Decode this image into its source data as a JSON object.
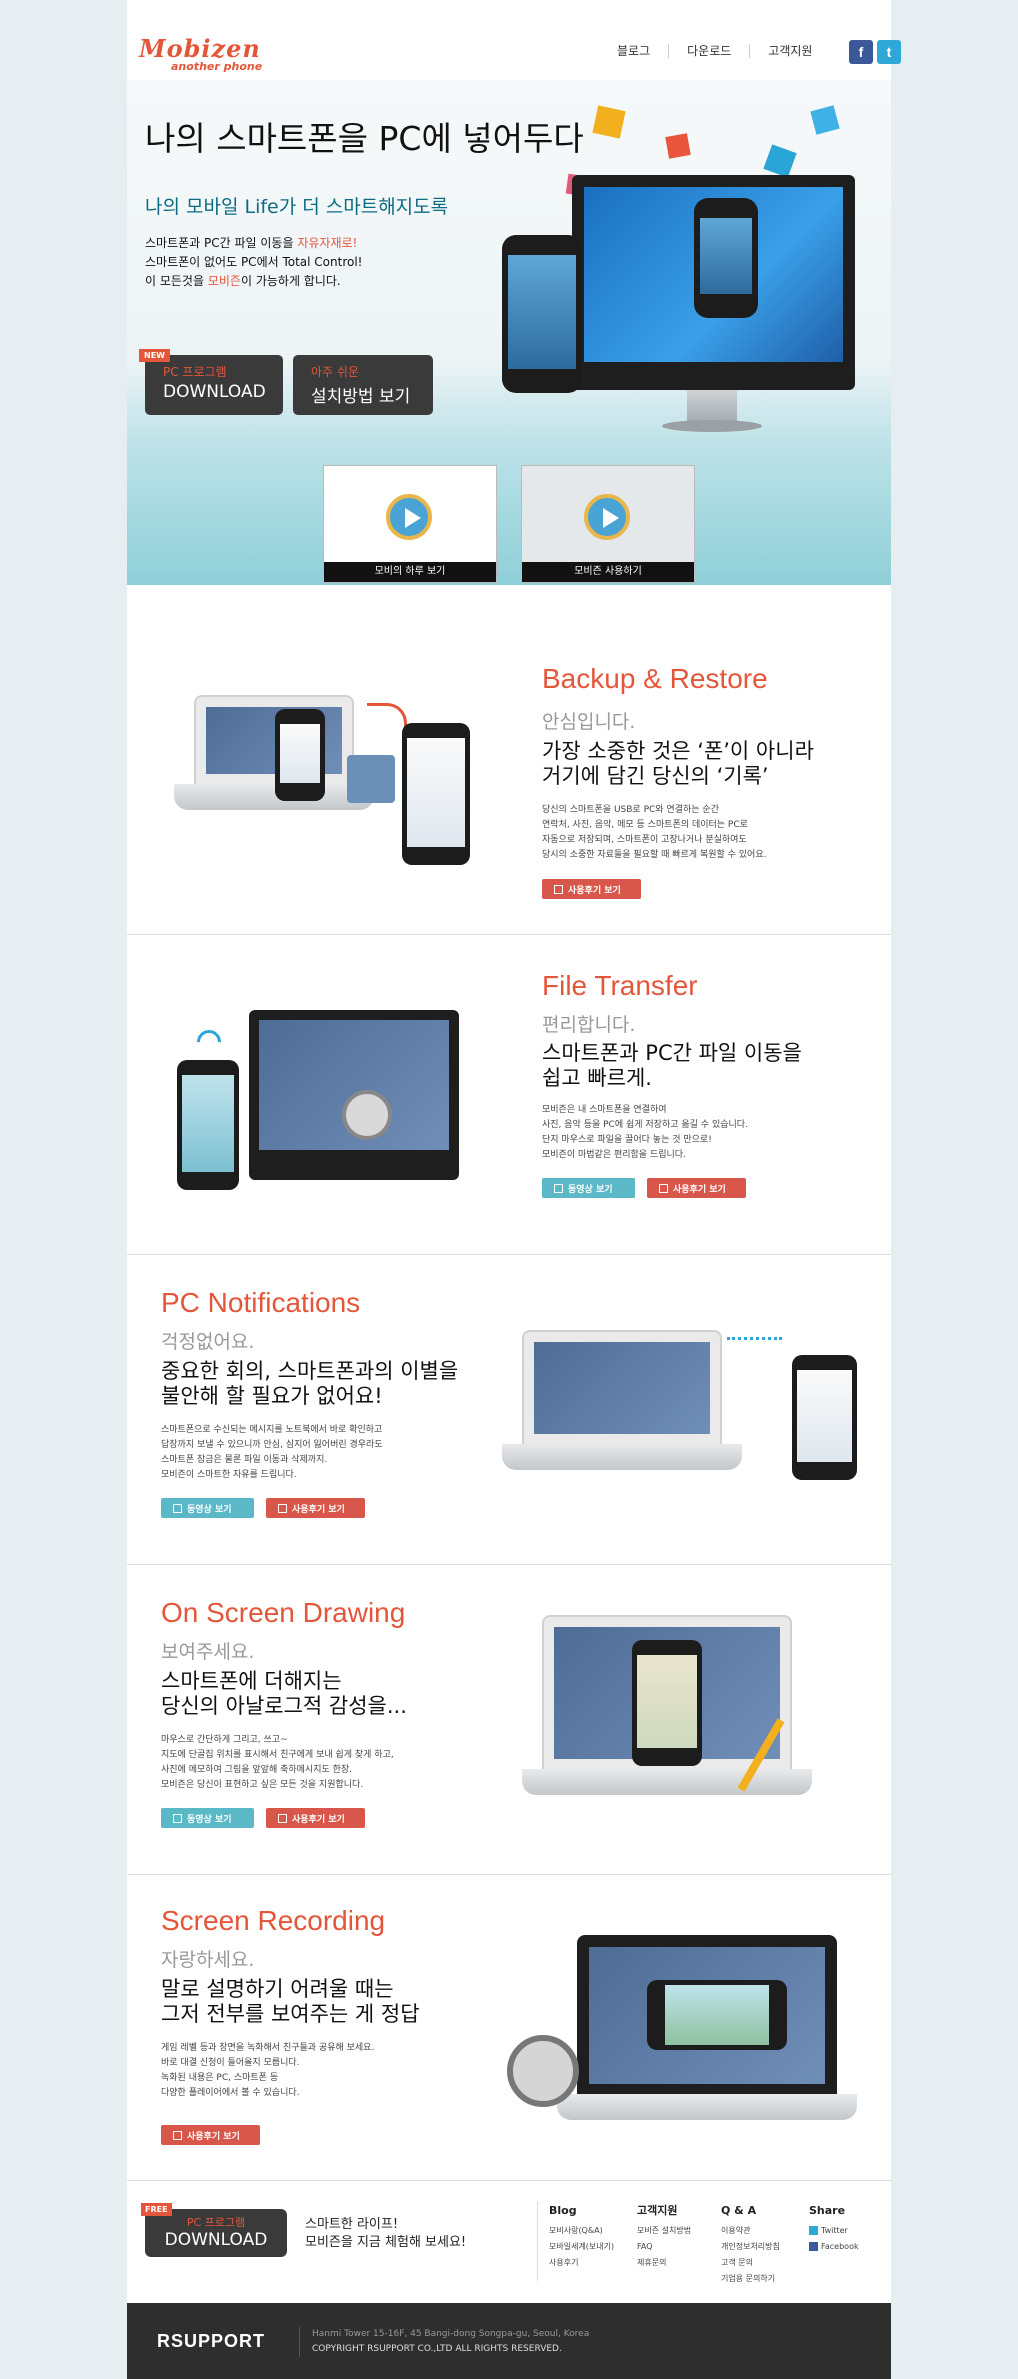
{
  "header": {
    "logo_main": "Mobizen",
    "logo_sub": "another phone",
    "nav": [
      "블로그",
      "다운로드",
      "고객지원"
    ],
    "social": [
      "f",
      "t"
    ]
  },
  "hero": {
    "title": "나의 스마트폰을 PC에 넣어두다",
    "subtitle": "나의 모바일 Life가 더 스마트해지도록",
    "line1_a": "스마트폰과 PC간 파일 이동을 ",
    "line1_b": "자유자재로!",
    "line2": "스마트폰이 없어도 PC에서 Total Control!",
    "line3_a": "이 모든것을 ",
    "line3_b": "모비즌",
    "line3_c": "이 가능하게 합니다.",
    "btn_download_tag": "NEW",
    "btn_download_small": "PC 프로그램",
    "btn_download_big": "DOWNLOAD",
    "btn_install_small": "아주 쉬운",
    "btn_install_big": "설치방법 보기",
    "video1_caption": "모비의 하루 보기",
    "video2_caption": "모비즌 사용하기"
  },
  "features": [
    {
      "title": "Backup & Restore",
      "sub": "안심입니다.",
      "head1": "가장 소중한 것은 ‘폰’이 아니라",
      "head2": "거기에 담긴 당신의 ‘기록’",
      "desc": [
        "당신의 스마트폰을 USB로 PC와 연결하는 순간",
        "연락처, 사진, 음악, 메모 등 스마트폰의 데이터는 PC로",
        "자동으로 저장되며, 스마트폰이 고장나거나 분실하여도",
        "당시의 소중한 자료들을 필요할 때 빠르게 복원할 수 있어요."
      ],
      "btn_review": "사용후기 보기"
    },
    {
      "title": "File Transfer",
      "sub": "편리합니다.",
      "head1": "스마트폰과 PC간 파일 이동을",
      "head2": "쉽고 빠르게.",
      "desc": [
        "모비즌은 내 스마트폰을 연결하여",
        "사진, 음악 등을 PC에 쉽게 저장하고 옮길 수 있습니다.",
        "단지 마우스로 파일을 끌어다 놓는 것 만으로!",
        "모비즌이 마법같은 편리함을 드립니다."
      ],
      "btn_video": "동영상 보기",
      "btn_review": "사용후기 보기"
    },
    {
      "title": "PC Notifications",
      "sub": "걱정없어요.",
      "head1": "중요한 회의, 스마트폰과의 이별을",
      "head2": "불안해 할 필요가 없어요!",
      "desc": [
        "스마트폰으로 수신되는 메시지를 노트북에서 바로 확인하고",
        "답장까지 보낼 수 있으니까 안심, 심지어 잃어버린 경우라도",
        "스마트폰 잠금은 물론 파일 이동과 삭제까지.",
        "모비즌이 스마트한 자유를 드립니다."
      ],
      "btn_video": "동영상 보기",
      "btn_review": "사용후기 보기"
    },
    {
      "title": "On Screen Drawing",
      "sub": "보여주세요.",
      "head1": "스마트폰에 더해지는",
      "head2": "당신의 아날로그적 감성을...",
      "desc": [
        "마우스로 간단하게 그리고, 쓰고~",
        "지도에 단골집 위치를 표시해서 친구에게 보내 쉽게 찾게 하고,",
        "사진에 메모하여 그림을 앞앞해 축하메시지도 한장.",
        "모비즌은 당신이 표현하고 싶은 모든 것을 지원합니다."
      ],
      "btn_video": "동영상 보기",
      "btn_review": "사용후기 보기"
    },
    {
      "title": "Screen Recording",
      "sub": "자랑하세요.",
      "head1": "말로 설명하기 어려울 때는",
      "head2": "그저 전부를 보여주는 게 정답",
      "desc": [
        "게임 레벨 등과 장면을 녹화해서 친구들과 공유해 보세요.",
        "바로 대결 신청이 들어올지 모릅니다.",
        "녹화된 내용은 PC, 스마트폰 등",
        "다양한 플레이어에서 볼 수 있습니다."
      ],
      "btn_review": "사용후기 보기"
    }
  ],
  "footer": {
    "free_tag": "FREE",
    "dl_small": "PC 프로그램",
    "dl_big": "DOWNLOAD",
    "tagline1": "스마트한 라이프!",
    "tagline2": "모비즌을 지금 체험해 보세요!",
    "cols": [
      {
        "title": "Blog",
        "items": [
          "모비사랑(Q&A)",
          "모바일세계(보내기)",
          "사용후기"
        ]
      },
      {
        "title": "고객지원",
        "items": [
          "모비즌 설치방법",
          "FAQ",
          "제휴문의"
        ]
      },
      {
        "title": "Q & A",
        "items": [
          "이용약관",
          "개인정보처리방침",
          "고객 문의",
          "기업용 문의하기"
        ]
      },
      {
        "title": "Share",
        "items": [
          "Twitter",
          "Facebook"
        ]
      }
    ],
    "brand": "RSUPPORT",
    "address": "Hanmi Tower 15-16F, 45 Bangi-dong Songpa-gu, Seoul, Korea",
    "copyright": "COPYRIGHT RSUPPORT CO.,LTD ALL RIGHTS RESERVED."
  }
}
